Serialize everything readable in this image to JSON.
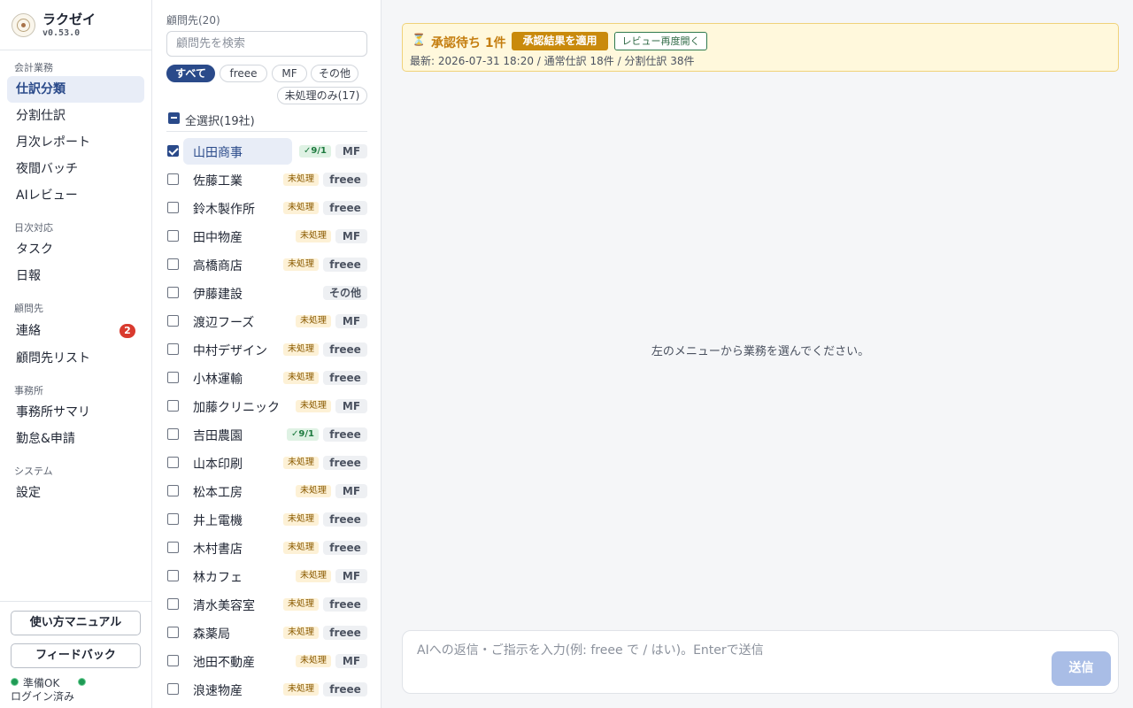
{
  "brand": {
    "name": "ラクゼイ",
    "version": "v0.53.0",
    "logo_text": ""
  },
  "sidebar": {
    "groups": [
      {
        "label": "会計業務",
        "items": [
          {
            "label": "仕訳分類"
          },
          {
            "label": "分割仕訳"
          },
          {
            "label": "月次レポート"
          },
          {
            "label": "夜間バッチ"
          },
          {
            "label": "AIレビュー"
          }
        ]
      },
      {
        "label": "日次対応",
        "items": [
          {
            "label": "タスク"
          },
          {
            "label": "日報"
          }
        ]
      },
      {
        "label": "顧問先",
        "items": [
          {
            "label": "連絡",
            "badge": "2"
          },
          {
            "label": "顧問先リスト"
          }
        ]
      },
      {
        "label": "事務所",
        "items": [
          {
            "label": "事務所サマリ"
          },
          {
            "label": "勤怠&申請"
          }
        ]
      },
      {
        "label": "システム",
        "items": [
          {
            "label": "設定"
          }
        ]
      }
    ],
    "active": "仕訳分類",
    "manual_label": "使い方マニュアル",
    "feedback_label": "フィードバック",
    "status_ready": "準備OK",
    "status_login": "ログイン済み"
  },
  "clients": {
    "title": "顧問先(20)",
    "search_placeholder": "顧問先を検索",
    "filters": {
      "all": "すべて",
      "freee": "freee",
      "mf": "MF",
      "other": "その他",
      "unprocessed": "未処理のみ(17)"
    },
    "select_all_label": "全選択(19社)",
    "rows": [
      {
        "name": "山田商事",
        "status": "✓9/1",
        "status_kind": "done",
        "software": "MF",
        "checked": true,
        "selected": true
      },
      {
        "name": "佐藤工業",
        "status": "未処理",
        "status_kind": "pending",
        "software": "freee",
        "checked": false
      },
      {
        "name": "鈴木製作所",
        "status": "未処理",
        "status_kind": "pending",
        "software": "freee",
        "checked": false
      },
      {
        "name": "田中物産",
        "status": "未処理",
        "status_kind": "pending",
        "software": "MF",
        "checked": false
      },
      {
        "name": "高橋商店",
        "status": "未処理",
        "status_kind": "pending",
        "software": "freee",
        "checked": false
      },
      {
        "name": "伊藤建設",
        "status": "",
        "status_kind": "none",
        "software": "その他",
        "checked": false
      },
      {
        "name": "渡辺フーズ",
        "status": "未処理",
        "status_kind": "pending",
        "software": "MF",
        "checked": false
      },
      {
        "name": "中村デザイン",
        "status": "未処理",
        "status_kind": "pending",
        "software": "freee",
        "checked": false
      },
      {
        "name": "小林運輸",
        "status": "未処理",
        "status_kind": "pending",
        "software": "freee",
        "checked": false
      },
      {
        "name": "加藤クリニック",
        "status": "未処理",
        "status_kind": "pending",
        "software": "MF",
        "checked": false
      },
      {
        "name": "吉田農園",
        "status": "✓9/1",
        "status_kind": "done",
        "software": "freee",
        "checked": false
      },
      {
        "name": "山本印刷",
        "status": "未処理",
        "status_kind": "pending",
        "software": "freee",
        "checked": false
      },
      {
        "name": "松本工房",
        "status": "未処理",
        "status_kind": "pending",
        "software": "MF",
        "checked": false
      },
      {
        "name": "井上電機",
        "status": "未処理",
        "status_kind": "pending",
        "software": "freee",
        "checked": false
      },
      {
        "name": "木村書店",
        "status": "未処理",
        "status_kind": "pending",
        "software": "freee",
        "checked": false
      },
      {
        "name": "林カフェ",
        "status": "未処理",
        "status_kind": "pending",
        "software": "MF",
        "checked": false
      },
      {
        "name": "清水美容室",
        "status": "未処理",
        "status_kind": "pending",
        "software": "freee",
        "checked": false
      },
      {
        "name": "森薬局",
        "status": "未処理",
        "status_kind": "pending",
        "software": "freee",
        "checked": false
      },
      {
        "name": "池田不動産",
        "status": "未処理",
        "status_kind": "pending",
        "software": "MF",
        "checked": false
      },
      {
        "name": "浪速物産",
        "status": "未処理",
        "status_kind": "pending",
        "software": "freee",
        "checked": false
      }
    ]
  },
  "banner": {
    "icon": "hourglass-icon",
    "title": "承認待ち 1件",
    "apply_label": "承認結果を適用",
    "reopen_label": "レビュー再度開く",
    "subtitle": "最新: 2026-07-31 18:20 / 通常仕訳 18件 / 分割仕訳 38件"
  },
  "main": {
    "placeholder": "左のメニューから業務を選んでください。"
  },
  "composer": {
    "placeholder": "AIへの返信・ご指示を入力(例: freee で / はい)。Enterで送信",
    "send_label": "送信"
  },
  "colors": {
    "accent": "#2a4a8a",
    "warning_bg": "#fff8dc",
    "apply_button": "#c98a0c",
    "send_button": "#a9bde6",
    "badge": "#d93a2e"
  }
}
